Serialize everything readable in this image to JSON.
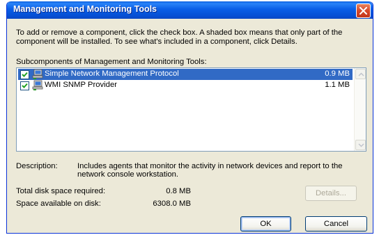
{
  "window": {
    "title": "Management and Monitoring Tools"
  },
  "intro": {
    "text": "To add or remove a component, click the check box. A shaded box means that only part of the component will be installed. To see what's included in a component, click Details."
  },
  "list": {
    "label": "Subcomponents of Management and Monitoring Tools:",
    "items": [
      {
        "name": "Simple Network Management Protocol",
        "size": "0.9 MB",
        "checked": true,
        "selected": true,
        "icon": "network-computer-icon"
      },
      {
        "name": "WMI SNMP Provider",
        "size": "1.1 MB",
        "checked": true,
        "selected": false,
        "icon": "network-computer-icon"
      }
    ]
  },
  "description": {
    "label": "Description:",
    "text": "Includes agents that monitor the activity in network devices and report to the network console workstation."
  },
  "disk": {
    "required_label": "Total disk space required:",
    "required_value": "0.8 MB",
    "available_label": "Space available on disk:",
    "available_value": "6308.0 MB"
  },
  "buttons": {
    "details": "Details...",
    "ok": "OK",
    "cancel": "Cancel"
  },
  "colors": {
    "titlebar": "#0a5ee6",
    "selection": "#316ac5",
    "dialog_bg": "#ece9d8"
  }
}
